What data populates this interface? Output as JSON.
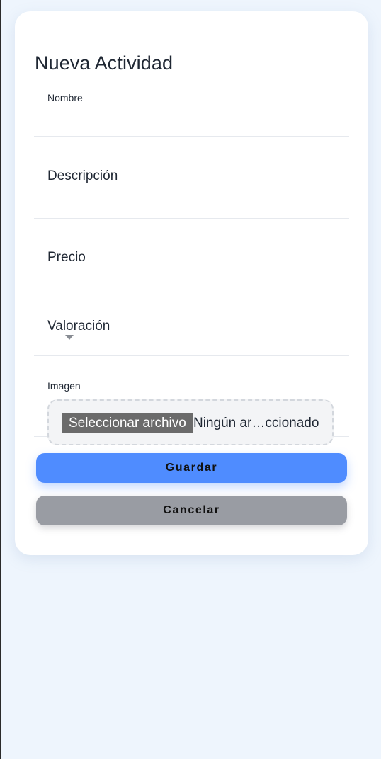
{
  "form": {
    "title": "Nueva Actividad",
    "fields": {
      "nombre": {
        "label": "Nombre",
        "value": ""
      },
      "descripcion": {
        "label": "Descripción",
        "value": ""
      },
      "precio": {
        "label": "Precio",
        "value": ""
      },
      "valoracion": {
        "label": "Valoración",
        "selected": ""
      },
      "imagen": {
        "label": "Imagen",
        "button_label": "Seleccionar archivo",
        "status": "Ningún ar…ccionado"
      }
    },
    "buttons": {
      "save": "Guardar",
      "cancel": "Cancelar"
    }
  },
  "colors": {
    "page_background": "#eef5fd",
    "card_background": "#ffffff",
    "primary_button": "#4f8cff",
    "secondary_button": "#999ca3"
  },
  "icons": {
    "select_arrow": "caret-down-icon"
  }
}
